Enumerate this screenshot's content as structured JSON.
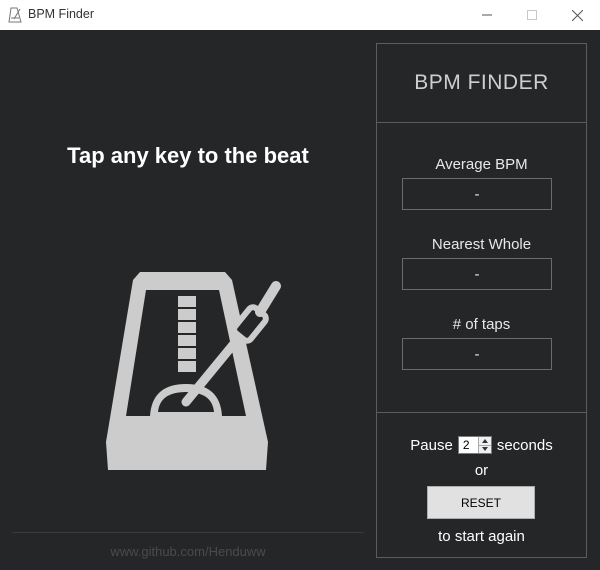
{
  "window": {
    "title": "BPM Finder",
    "icon": "metronome-icon",
    "controls": {
      "minimize": "minimize-icon",
      "maximize": "maximize-icon",
      "close": "close-icon"
    }
  },
  "main": {
    "headline": "Tap any key to the beat",
    "illustration": "metronome-icon",
    "footer_link": "www.github.com/Henduww"
  },
  "panel": {
    "title": "BPM FINDER",
    "average_bpm": {
      "label": "Average BPM",
      "value": "-"
    },
    "nearest_whole": {
      "label": "Nearest Whole",
      "value": "-"
    },
    "tap_count": {
      "label": "# of taps",
      "value": "-"
    },
    "pause": {
      "prefix": "Pause",
      "value": "2",
      "suffix": "seconds"
    },
    "or_text": "or",
    "reset_label": "RESET",
    "again_text": "to start again"
  },
  "colors": {
    "background": "#252627",
    "panel_border": "#5b5c5e",
    "metronome": "#cccccc",
    "footer_text": "#4a4b4d"
  }
}
